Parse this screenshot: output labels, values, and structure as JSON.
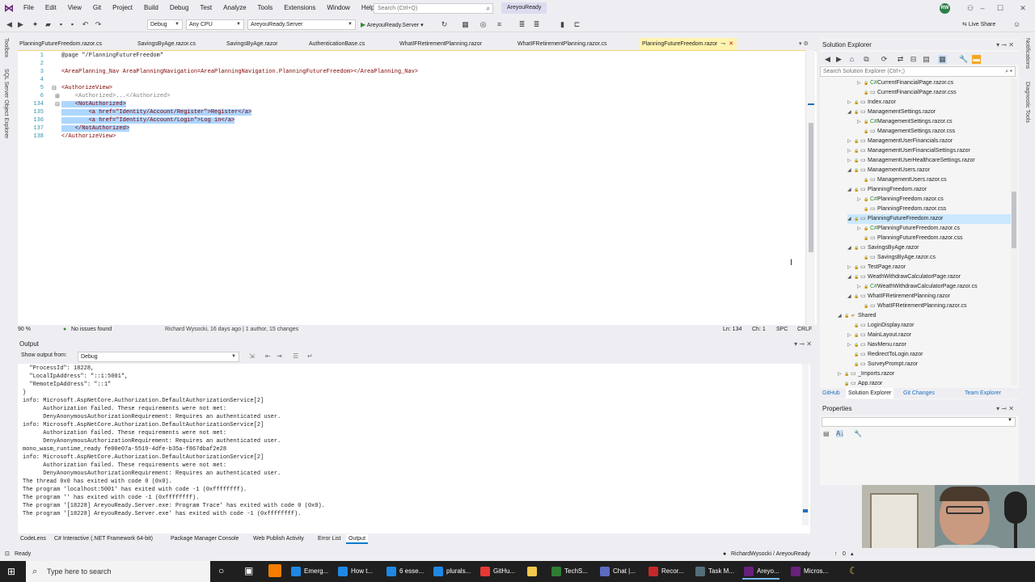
{
  "menu": [
    "File",
    "Edit",
    "View",
    "Git",
    "Project",
    "Build",
    "Debug",
    "Test",
    "Analyze",
    "Tools",
    "Extensions",
    "Window",
    "Help"
  ],
  "search_placeholder": "Search (Ctrl+Q)",
  "solution_name": "AreyouReady",
  "avatar_initials": "RW",
  "toolbar": {
    "config": "Debug",
    "platform": "Any CPU",
    "startup_project": "AreyouReady.Server",
    "run_label": "AreyouReady.Server",
    "live_share": "Live Share"
  },
  "left_strip": [
    "Toolbox",
    "SQL Server Object Explorer"
  ],
  "right_strip": [
    "Notifications",
    "Diagnostic Tools"
  ],
  "tabs": [
    {
      "label": "PlanningFutureFreedom.razor.cs"
    },
    {
      "label": "SavingsByAge.razor.cs"
    },
    {
      "label": "SavingsByAge.razor"
    },
    {
      "label": "AuthenticationBase.cs"
    },
    {
      "label": "WhatIFRetirementPlanning.razor"
    },
    {
      "label": "WhatIFRetirementPlanning.razor.cs"
    },
    {
      "label": "PlanningFutureFreedom.razor",
      "active": true
    }
  ],
  "code": {
    "lines": [
      {
        "n": "1",
        "t": "@page \"/PlanningFutureFreedom\""
      },
      {
        "n": "2",
        "t": ""
      },
      {
        "n": "3",
        "t": "<AreaPlanning_Nav AreaPlanningNavigation=AreaPlanningNavigation.PlanningFutureFreedom></AreaPlanning_Nav>"
      },
      {
        "n": "4",
        "t": ""
      },
      {
        "n": "5",
        "t": "<AuthorizeView>"
      },
      {
        "n": "6",
        "t": "    <Authorized>...</Authorized>"
      },
      {
        "n": "134",
        "t": "    <NotAuthorized>"
      },
      {
        "n": "135",
        "t": "        <a href=\"Identity/Account/Register\">Register</a>"
      },
      {
        "n": "136",
        "t": "        <a href=\"Identity/Account/Login\">Log in</a>"
      },
      {
        "n": "137",
        "t": "    </NotAuthorized>"
      },
      {
        "n": "138",
        "t": "</AuthorizeView>"
      }
    ]
  },
  "editor_status": {
    "zoom": "90 %",
    "issues": "No issues found",
    "blame": "Richard Wysocki, 16 days ago | 1 author, 15 changes",
    "position": "Ln: 134",
    "col": "Ch: 1",
    "ws": "SPC",
    "eol": "CRLF"
  },
  "output": {
    "title": "Output",
    "show_from_label": "Show output from:",
    "source": "Debug",
    "lines": [
      "  \"ProcessId\": 18228,",
      "  \"LocalIpAddress\": \"::1:5001\",",
      "  \"RemoteIpAddress\": \"::1\"",
      "}",
      "info: Microsoft.AspNetCore.Authorization.DefaultAuthorizationService[2]",
      "      Authorization failed. These requirements were not met:",
      "      DenyAnonymousAuthorizationRequirement: Requires an authenticated user.",
      "info: Microsoft.AspNetCore.Authorization.DefaultAuthorizationService[2]",
      "      Authorization failed. These requirements were not met:",
      "      DenyAnonymousAuthorizationRequirement: Requires an authenticated user.",
      "mono_wasm_runtime_ready fe00e07a-5519-4dfe-b35a-f867dbaf2e28",
      "info: Microsoft.AspNetCore.Authorization.DefaultAuthorizationService[2]",
      "      Authorization failed. These requirements were not met:",
      "      DenyAnonymousAuthorizationRequirement: Requires an authenticated user.",
      "The thread 0x0 has exited with code 0 (0x0).",
      "The program 'localhost:5001' has exited with code -1 (0xffffffff).",
      "The program '' has exited with code -1 (0xffffffff).",
      "The program '[18228] AreyouReady.Server.exe: Program Trace' has exited with code 0 (0x0).",
      "The program '[18228] AreyouReady.Server.exe' has exited with code -1 (0xffffffff)."
    ]
  },
  "bottom_tabs": [
    "CodeLens",
    "C# Interactive (.NET Framework 64-bit)",
    "Package Manager Console",
    "Web Publish Activity",
    "Error List",
    "Output"
  ],
  "solution_explorer": {
    "title": "Solution Explorer",
    "search_placeholder": "Search Solution Explorer (Ctrl+;)",
    "items": [
      {
        "label": "CurrentFinancialPage.razor.cs",
        "depth": 2,
        "icon": "C#",
        "exp": "▷"
      },
      {
        "label": "CurrentFinancialPage.razor.css",
        "depth": 2,
        "icon": "▭",
        "exp": ""
      },
      {
        "label": "Index.razor",
        "depth": 1,
        "icon": "▭",
        "exp": "▷"
      },
      {
        "label": "ManagementSettings.razor",
        "depth": 1,
        "icon": "▭",
        "exp": "◢"
      },
      {
        "label": "ManagementSettings.razor.cs",
        "depth": 2,
        "icon": "C#",
        "exp": "▷"
      },
      {
        "label": "ManagementSettings.razor.css",
        "depth": 2,
        "icon": "▭",
        "exp": ""
      },
      {
        "label": "ManagementUserFinancials.razor",
        "depth": 1,
        "icon": "▭",
        "exp": "▷"
      },
      {
        "label": "ManagementUserFinancialSettings.razor",
        "depth": 1,
        "icon": "▭",
        "exp": "▷"
      },
      {
        "label": "ManagementUserHealthcareSettings.razor",
        "depth": 1,
        "icon": "▭",
        "exp": "▷"
      },
      {
        "label": "ManagementUsers.razor",
        "depth": 1,
        "icon": "▭",
        "exp": "◢"
      },
      {
        "label": "ManagementUsers.razor.cs",
        "depth": 2,
        "icon": "▭",
        "exp": ""
      },
      {
        "label": "PlanningFreedom.razor",
        "depth": 1,
        "icon": "▭",
        "exp": "◢"
      },
      {
        "label": "PlanningFreedom.razor.cs",
        "depth": 2,
        "icon": "C#",
        "exp": "▷"
      },
      {
        "label": "PlanningFreedom.razor.css",
        "depth": 2,
        "icon": "▭",
        "exp": ""
      },
      {
        "label": "PlanningFutureFreedom.razor",
        "depth": 1,
        "icon": "▭",
        "exp": "◢",
        "sel": true
      },
      {
        "label": "PlanningFutureFreedom.razor.cs",
        "depth": 2,
        "icon": "C#",
        "exp": "▷"
      },
      {
        "label": "PlanningFutureFreedom.razor.css",
        "depth": 2,
        "icon": "▭",
        "exp": ""
      },
      {
        "label": "SavingsByAge.razor",
        "depth": 1,
        "icon": "▭",
        "exp": "◢"
      },
      {
        "label": "SavingsByAge.razor.cs",
        "depth": 2,
        "icon": "▭",
        "exp": ""
      },
      {
        "label": "TestPage.razor",
        "depth": 1,
        "icon": "▭",
        "exp": "▷"
      },
      {
        "label": "WeathWithdrawCalculatorPage.razor",
        "depth": 1,
        "icon": "▭",
        "exp": "◢"
      },
      {
        "label": "WeathWithdrawCalculatorPage.razor.cs",
        "depth": 2,
        "icon": "C#",
        "exp": "▷"
      },
      {
        "label": "WhatIFRetirementPlanning.razor",
        "depth": 1,
        "icon": "▭",
        "exp": "◢"
      },
      {
        "label": "WhatIFRetirementPlanning.razor.cs",
        "depth": 2,
        "icon": "▭",
        "exp": ""
      },
      {
        "label": "Shared",
        "depth": 0,
        "icon": "▰",
        "exp": "◢"
      },
      {
        "label": "LoginDisplay.razor",
        "depth": 1,
        "icon": "▭",
        "exp": ""
      },
      {
        "label": "MainLayout.razor",
        "depth": 1,
        "icon": "▭",
        "exp": "▷"
      },
      {
        "label": "NavMenu.razor",
        "depth": 1,
        "icon": "▭",
        "exp": "▷"
      },
      {
        "label": "RedirectToLogin.razor",
        "depth": 1,
        "icon": "▭",
        "exp": ""
      },
      {
        "label": "SurveyPrompt.razor",
        "depth": 1,
        "icon": "▭",
        "exp": ""
      },
      {
        "label": "_Imports.razor",
        "depth": 0,
        "icon": "▭",
        "exp": "▷"
      },
      {
        "label": "App.razor",
        "depth": 0,
        "icon": "▭",
        "exp": ""
      }
    ],
    "tabs": [
      "GitHub",
      "Solution Explorer",
      "Git Changes",
      "Team Explorer"
    ]
  },
  "properties_title": "Properties",
  "statusbar": {
    "ready": "Ready",
    "repo": "RichardWysocki / AreyouReady",
    "branch_count": "0"
  },
  "taskbar": {
    "search": "Type here to search",
    "apps": [
      {
        "label": "Emerg...",
        "color": "#1e88e5"
      },
      {
        "label": "How t...",
        "color": "#1e88e5"
      },
      {
        "label": "6 esse...",
        "color": "#1e88e5"
      },
      {
        "label": "plurals...",
        "color": "#1e88e5"
      },
      {
        "label": "GitHu...",
        "color": "#e53935"
      },
      {
        "label": "",
        "color": "#f2c94c"
      },
      {
        "label": "TechS...",
        "color": "#2e7d32"
      },
      {
        "label": "Chat |...",
        "color": "#5c6bc0"
      },
      {
        "label": "Recor...",
        "color": "#c62828"
      },
      {
        "label": "Task M...",
        "color": "#546e7a"
      },
      {
        "label": "Areyo...",
        "color": "#68217a"
      },
      {
        "label": "Micros...",
        "color": "#68217a"
      }
    ]
  }
}
